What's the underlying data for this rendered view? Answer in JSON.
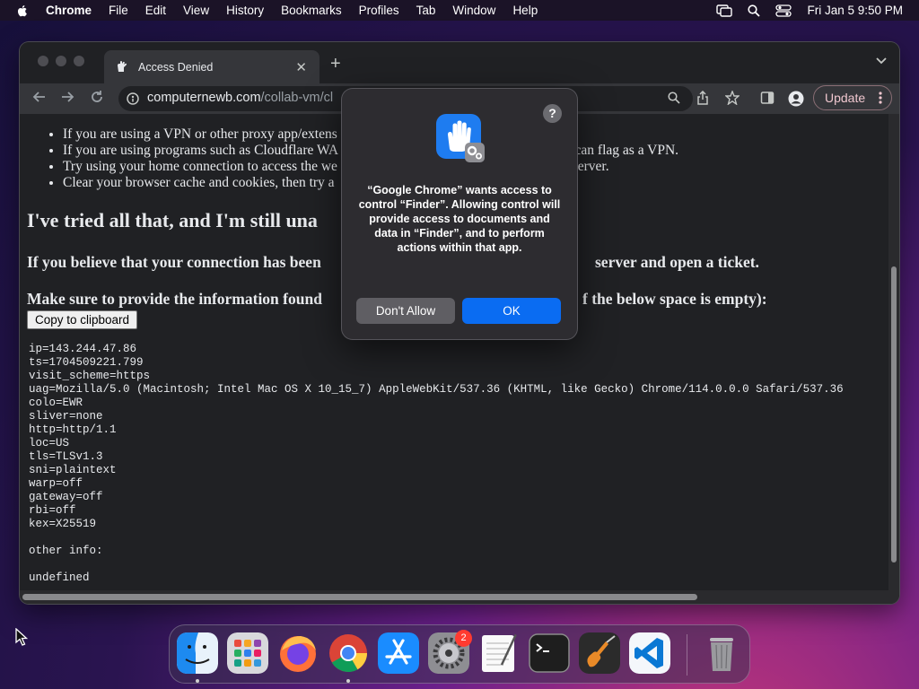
{
  "menubar": {
    "app_name": "Chrome",
    "items": [
      "File",
      "Edit",
      "View",
      "History",
      "Bookmarks",
      "Profiles",
      "Tab",
      "Window",
      "Help"
    ],
    "clock": "Fri Jan 5  9:50 PM"
  },
  "browser": {
    "tab_title": "Access Denied",
    "url_host": "computernewb.com",
    "url_path": "/collab-vm/cl",
    "update_label": "Update"
  },
  "page": {
    "bullets": [
      "If you are using a VPN or other proxy app/extens",
      "If you are using programs such as Cloudflare WA                                                        as they can flag as a VPN.",
      "Try using your home connection to access the we                                                        tion or server.",
      "Clear your browser cache and cookies, then try a"
    ],
    "heading_tried": "I've tried all that, and I'm still una",
    "heading_connection_left": "If you believe that your connection has been",
    "heading_connection_right": "server and open a ticket.",
    "heading_info_left": "Make sure to provide the information found",
    "heading_info_right": "f the below space is empty):",
    "copy_button": "Copy to clipboard",
    "trace_lines": [
      "ip=143.244.47.86",
      "ts=1704509221.799",
      "visit_scheme=https",
      "uag=Mozilla/5.0 (Macintosh; Intel Mac OS X 10_15_7) AppleWebKit/537.36 (KHTML, like Gecko) Chrome/114.0.0.0 Safari/537.36",
      "colo=EWR",
      "sliver=none",
      "http=http/1.1",
      "loc=US",
      "tls=TLSv1.3",
      "sni=plaintext",
      "warp=off",
      "gateway=off",
      "rbi=off",
      "kex=X25519",
      "",
      "other info:",
      "",
      "undefined"
    ]
  },
  "dialog": {
    "help": "?",
    "message": "“Google Chrome” wants access to control “Finder”. Allowing control will provide access to documents and data in “Finder”, and to perform actions within that app.",
    "deny_label": "Don't Allow",
    "ok_label": "OK",
    "icon": "privacy-hand-icon"
  },
  "dock": {
    "apps": [
      "Finder",
      "Launchpad",
      "Firefox",
      "Chrome",
      "App Store",
      "System Settings",
      "TextEdit",
      "Terminal",
      "GarageBand",
      "Visual Studio Code",
      "Trash"
    ],
    "settings_badge": "2"
  },
  "colors": {
    "accent_blue": "#0a6cf2",
    "page_bg": "#202124",
    "badge_red": "#ff3b30"
  }
}
